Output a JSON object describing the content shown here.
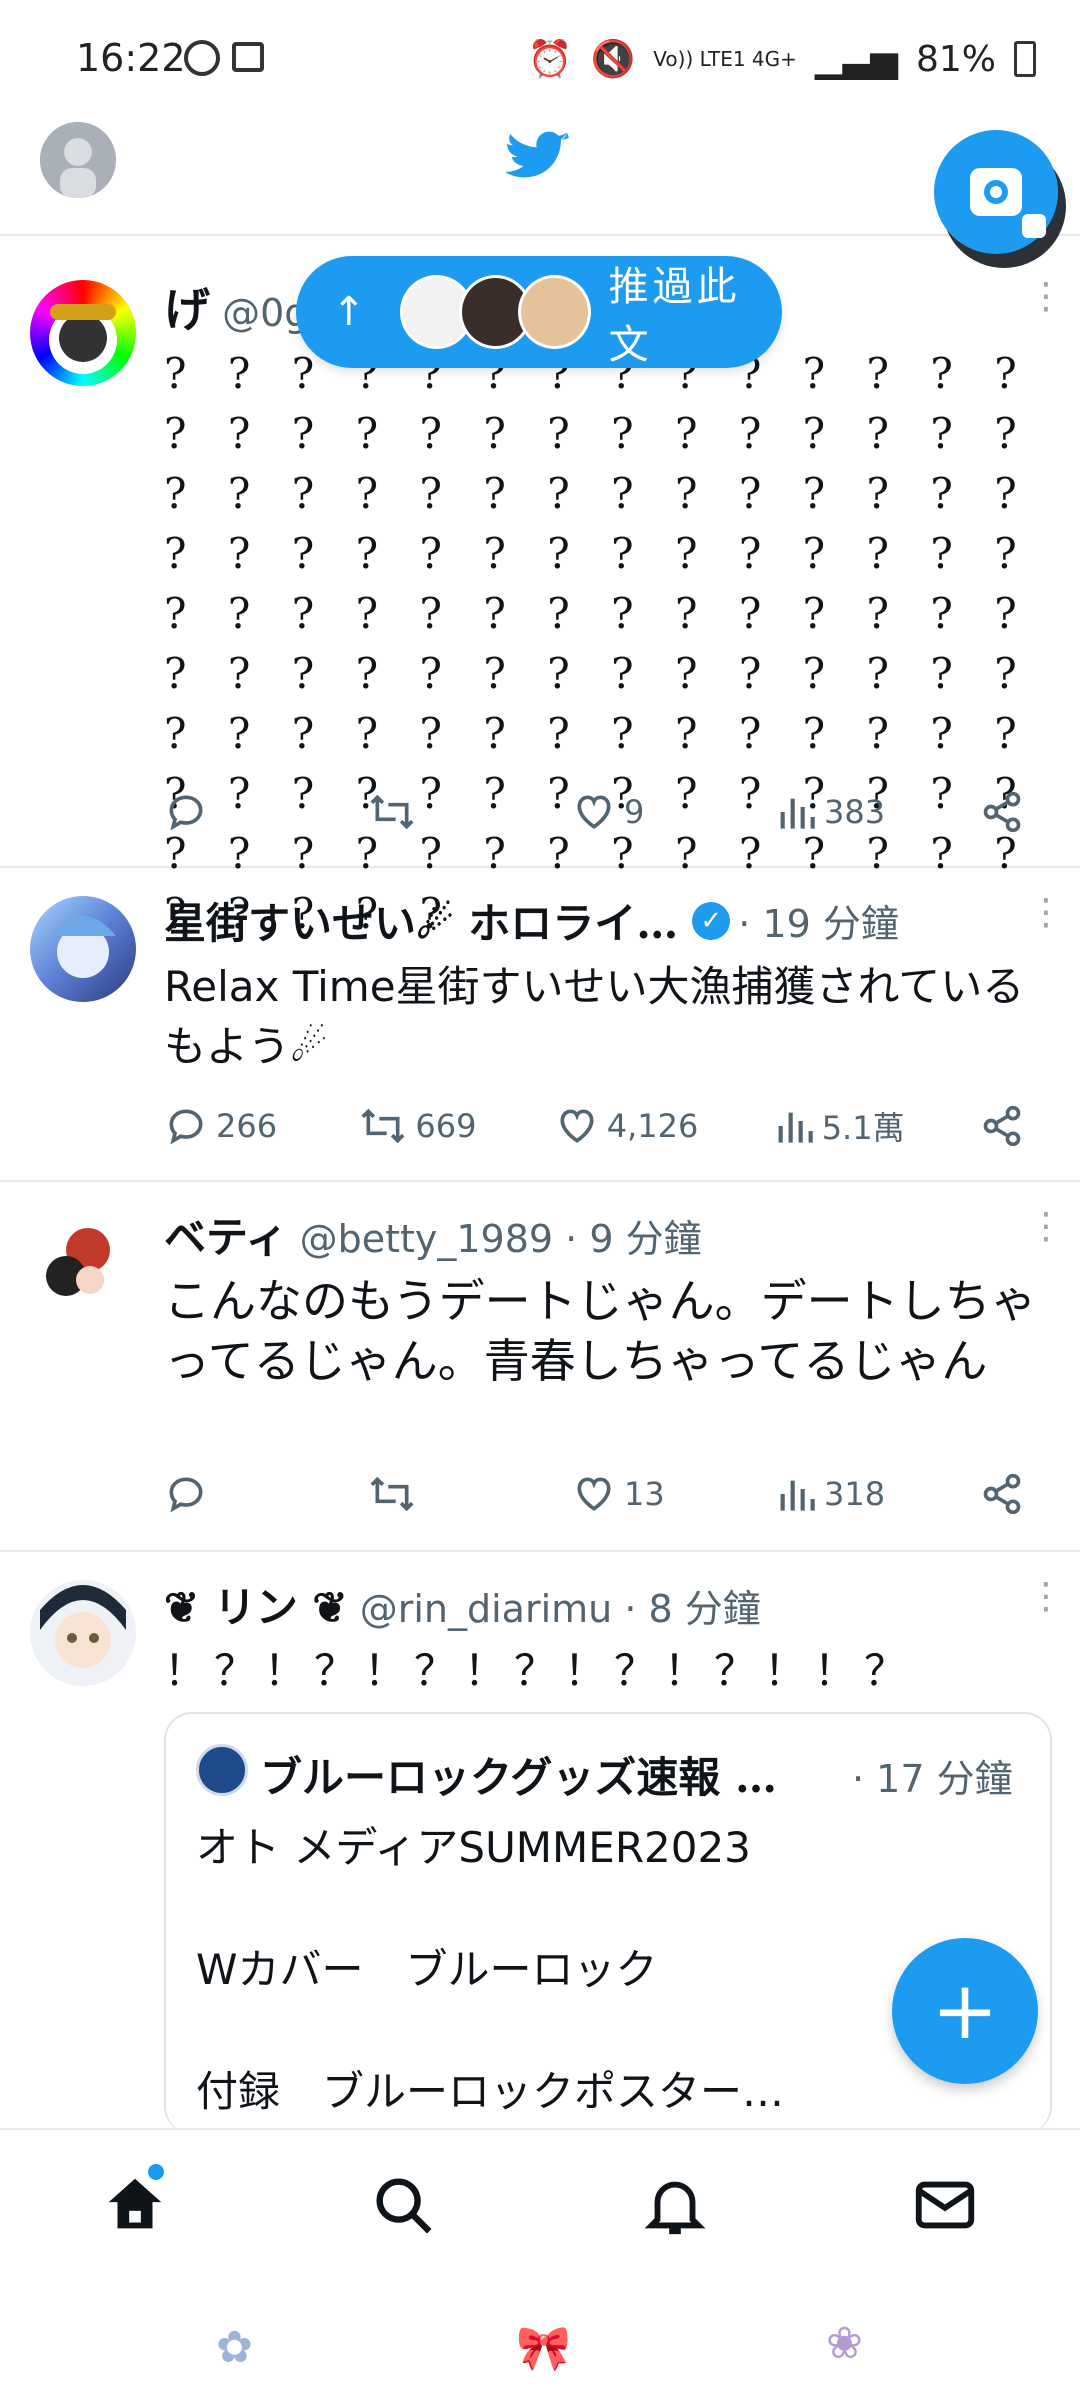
{
  "status_bar": {
    "time": "16:22",
    "network": "Vo)) LTE1 4G+",
    "battery": "81%"
  },
  "pill": {
    "label": "推過此文"
  },
  "tweets": [
    {
      "name": "げ",
      "handle": "@0g",
      "text": "? ? ? ? ? ? ? ? ? ? ? ? ? ? ? ? ? ? ? ? ? ? ? ? ? ? ? ? ? ? ? ? ? ? ? ? ? ? ? ? ? ? ? ? ? ? ? ? ? ? ? ? ? ? ? ? ? ? ? ? ? ? ? ? ? ? ? ? ? ? ? ? ? ? ? ? ? ? ? ? ? ? ? ? ? ? ? ? ? ? ? ? ? ? ? ? ? ? ? ? ? ? ? ? ? ? ? ? ? ? ? ? ? ? ? ? ? ? ? ? ? ? ? ? ? ? ? ? ? ? ?",
      "replies": "",
      "retweets": "",
      "likes": "9",
      "views": "383"
    },
    {
      "name": "星街すいせい☄ ホロライ…",
      "verified": true,
      "time": "· 19 分鐘",
      "text": "Relax Time星街すいせい大漁捕獲されているもよう☄",
      "replies": "266",
      "retweets": "669",
      "likes": "4,126",
      "views": "5.1萬"
    },
    {
      "name": "ベティ",
      "handle": "@betty_1989",
      "time": "· 9 分鐘",
      "text": "こんなのもうデートじゃん。デートしちゃってるじゃん。青春しちゃってるじゃん",
      "replies": "",
      "retweets": "",
      "likes": "13",
      "views": "318"
    },
    {
      "name": "❦ リン ❦",
      "handle": "@rin_diarimu",
      "time": "· 8 分鐘",
      "text": "！？！？！？！？！？！？！！？"
    }
  ],
  "quote": {
    "name": "ブルーロックグッズ速報 …",
    "time": "· 17 分鐘",
    "line1": "オト メディアSUMMER2023",
    "line2": "Wカバー　ブルーロック",
    "line3": "付録　ブルーロックポスター…"
  },
  "compose": {
    "label": "+"
  },
  "colors": {
    "accent": "#1d9bf0",
    "text": "#0f1419",
    "muted": "#536471"
  },
  "nav": {
    "items": [
      "home-icon",
      "search-icon",
      "bell-icon",
      "mail-icon"
    ]
  }
}
